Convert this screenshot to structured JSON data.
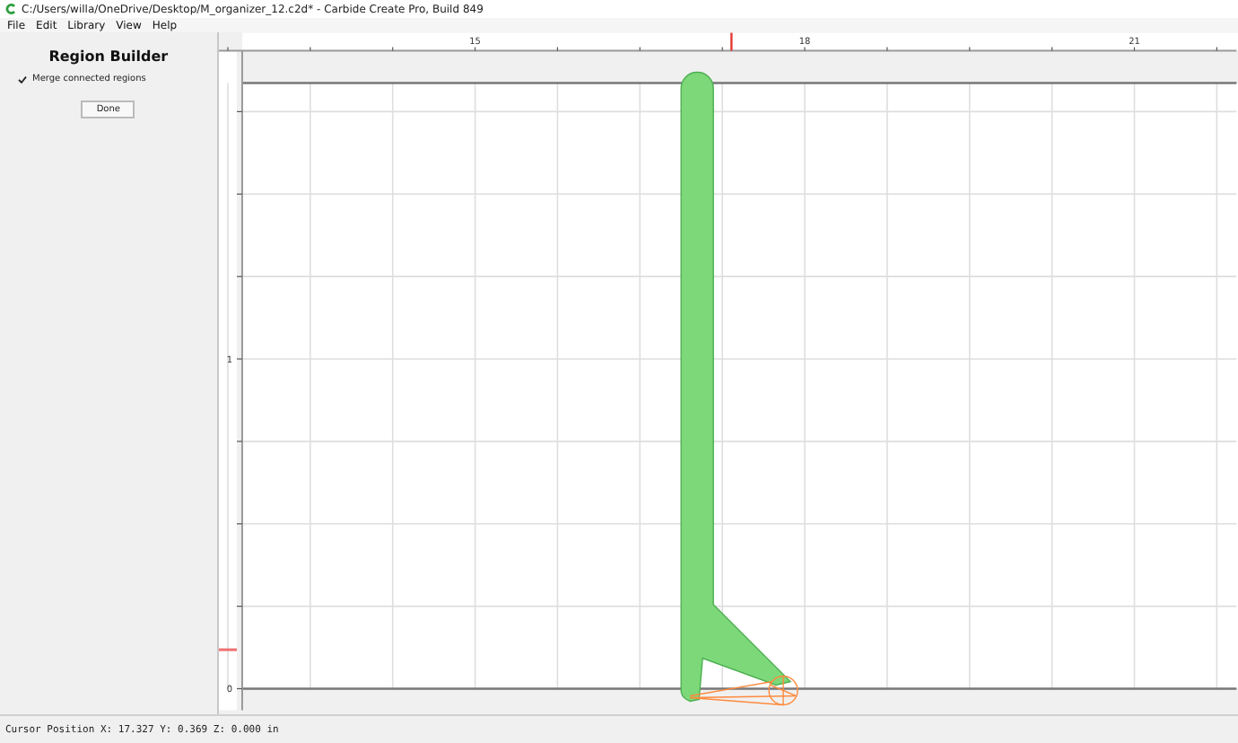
{
  "window": {
    "title": "C:/Users/willa/OneDrive/Desktop/M_organizer_12.c2d* - Carbide Create Pro, Build 849"
  },
  "menu": [
    "File",
    "Edit",
    "Library",
    "View",
    "Help"
  ],
  "panel": {
    "title": "Region Builder",
    "option": {
      "label": "Merge connected regions",
      "checked": true
    },
    "button": "Done"
  },
  "ruler_top": {
    "labels": [
      "15",
      "18",
      "21"
    ]
  },
  "ruler_left": {
    "labels": [
      "1",
      "0"
    ]
  },
  "status_bar": "Cursor Position X: 17.327 Y: 0.369 Z: 0.000 in"
}
